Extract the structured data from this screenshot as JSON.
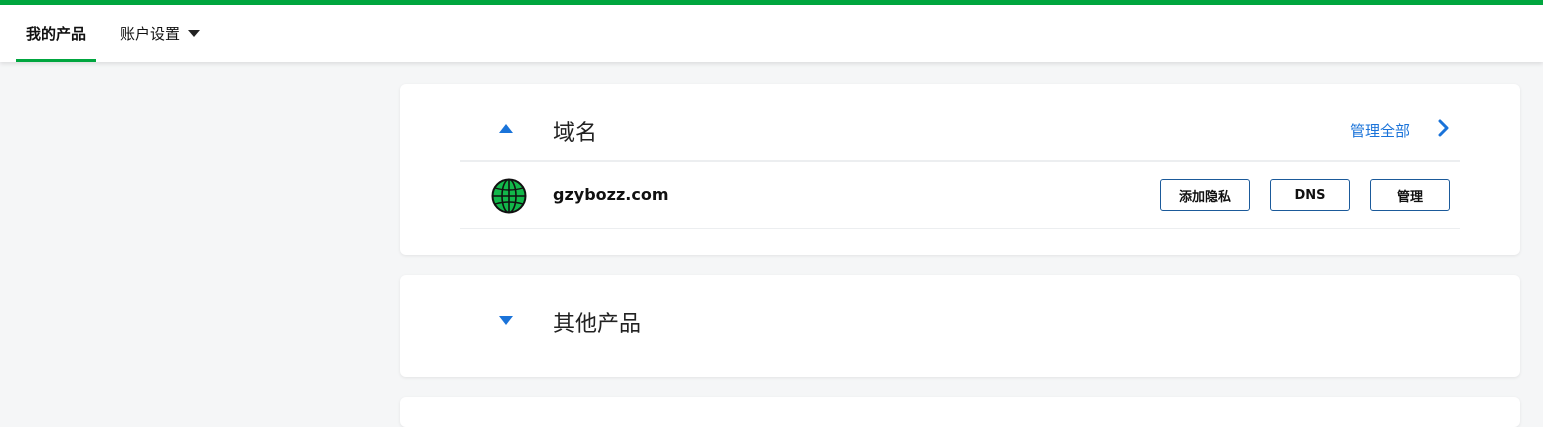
{
  "brand": {
    "accent": "#00a63f",
    "link": "#1a73d9"
  },
  "nav": {
    "tabs": [
      {
        "label": "我的产品",
        "active": true
      },
      {
        "label": "账户设置",
        "has_dropdown": true
      }
    ]
  },
  "domains_section": {
    "title": "域名",
    "expanded": true,
    "manage_all_label": "管理全部",
    "icons": {
      "toggle": "triangle-up-icon",
      "more": "chevron-right-icon"
    },
    "items": [
      {
        "icon": "globe-icon",
        "name": "gzybozz.com",
        "actions": {
          "privacy": "添加隐私",
          "dns": "DNS",
          "manage": "管理"
        }
      }
    ]
  },
  "other_section": {
    "title": "其他产品",
    "expanded": false,
    "icons": {
      "toggle": "triangle-down-icon"
    }
  }
}
